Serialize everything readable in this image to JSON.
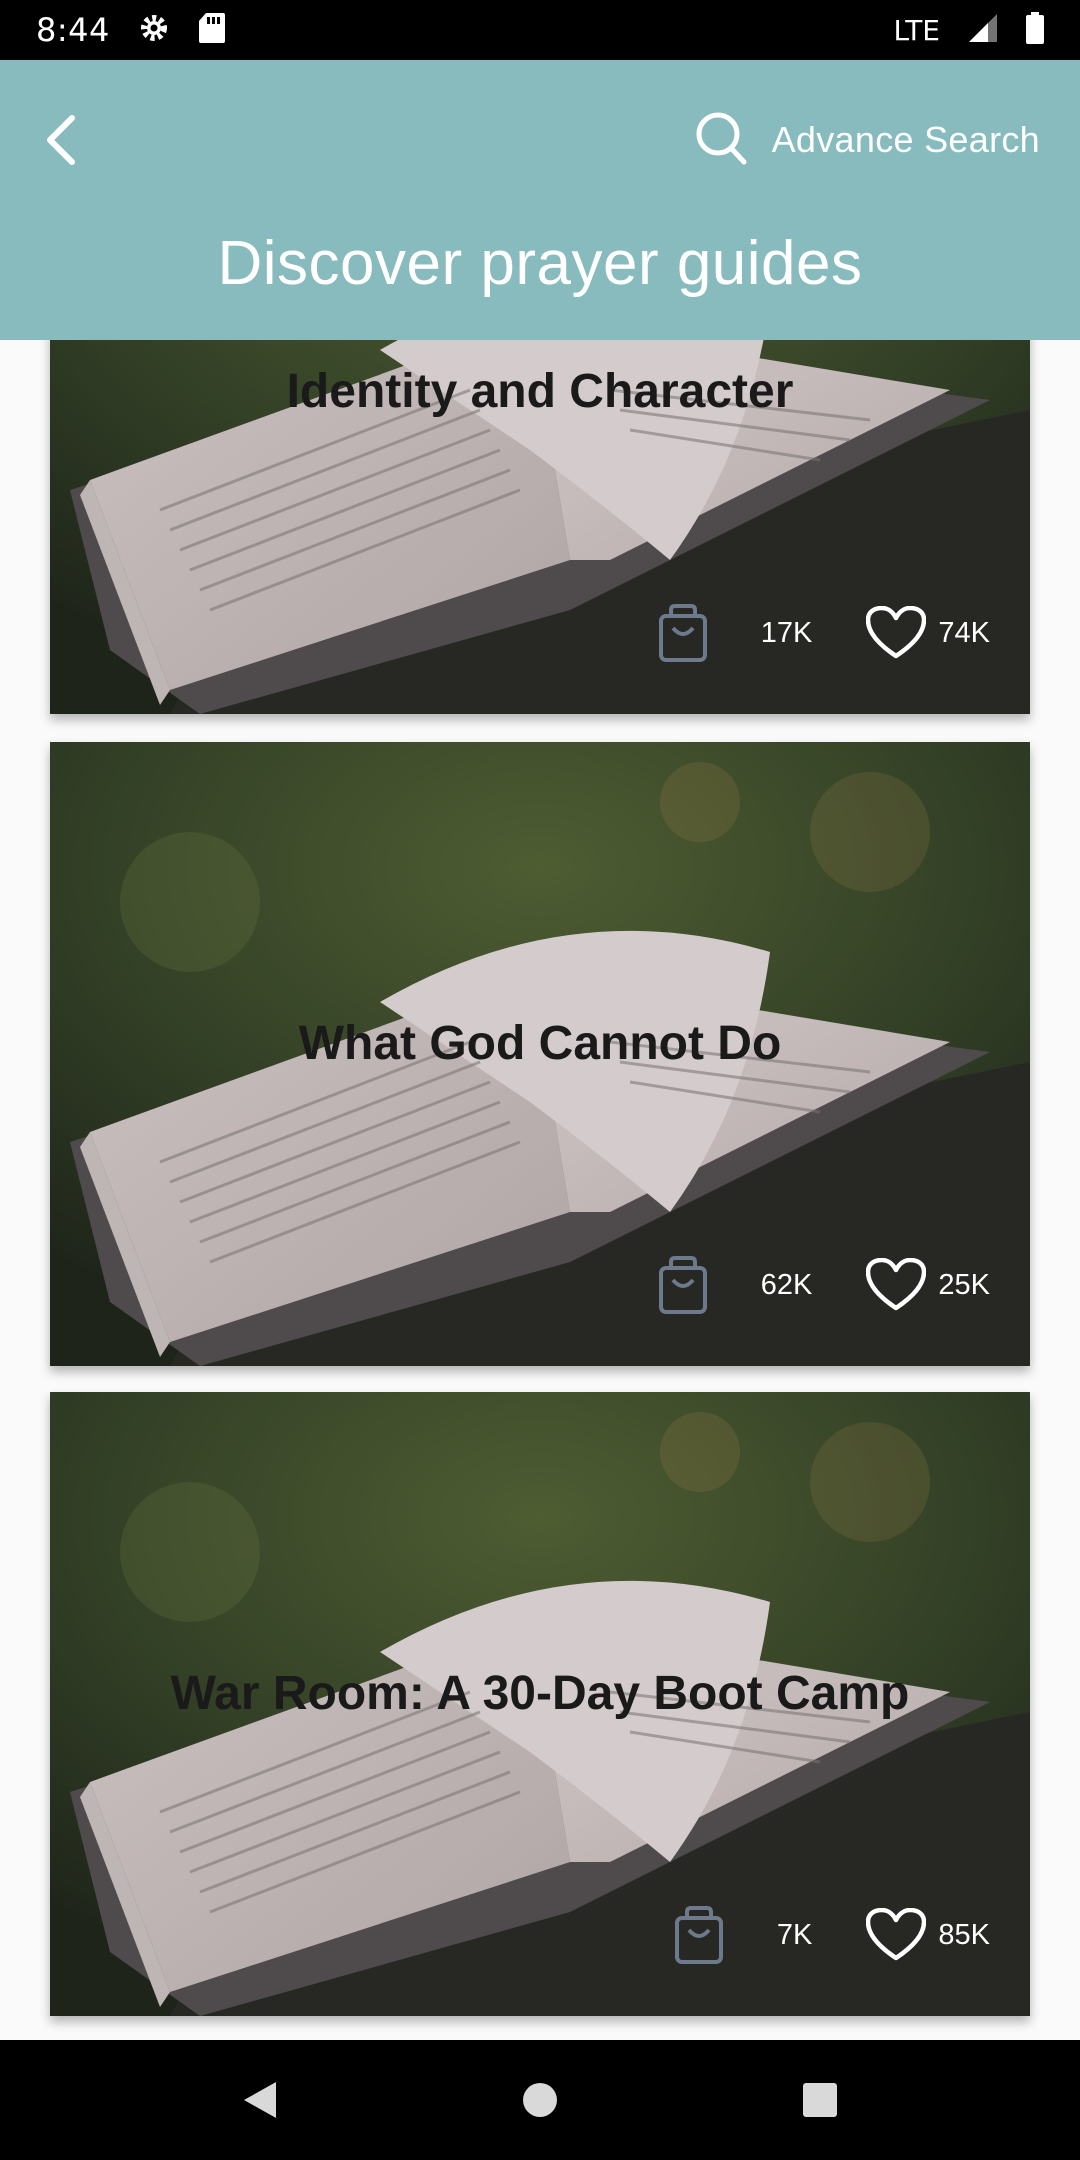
{
  "status_bar": {
    "time": "8:44",
    "network": "LTE",
    "icons": [
      "gear-icon",
      "sd-card-icon",
      "signal-icon",
      "battery-icon"
    ]
  },
  "header": {
    "back_icon": "back-arrow-icon",
    "search_icon": "search-icon",
    "search_label": "Advance Search",
    "title": "Discover prayer guides",
    "background_color": "#88bbbd"
  },
  "cards": [
    {
      "title": "Identity and Character",
      "bag_count": "17K",
      "likes": "74K"
    },
    {
      "title": "What God Cannot Do",
      "bag_count": "62K",
      "likes": "25K"
    },
    {
      "title": "War Room: A 30-Day Boot Camp",
      "bag_count": "7K",
      "likes": "85K"
    }
  ],
  "nav_bar": {
    "icons": [
      "nav-back-icon",
      "nav-home-icon",
      "nav-recents-icon"
    ]
  }
}
